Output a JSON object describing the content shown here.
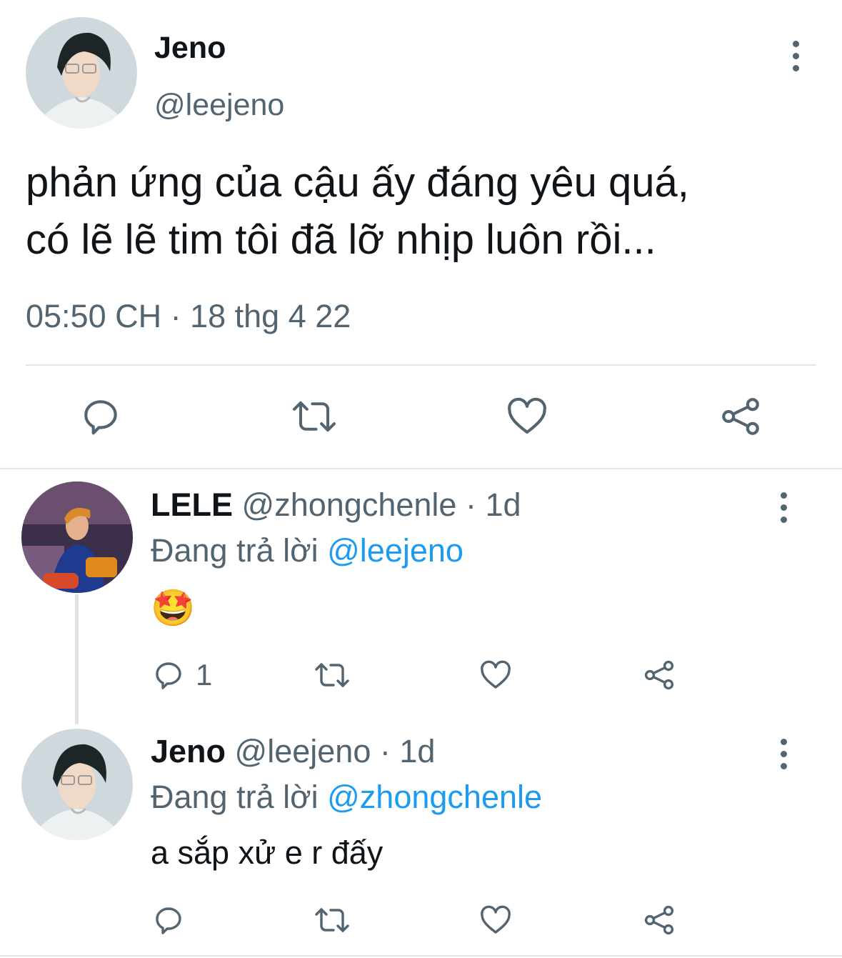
{
  "main_tweet": {
    "display_name": "Jeno",
    "handle": "@leejeno",
    "text_line1": "phản ứng của cậu ấy đáng yêu quá,",
    "text_line2": "có lẽ lẽ tim tôi đã lỡ nhịp luôn rồi...",
    "timestamp": "05:50 CH · 18 thg 4 22"
  },
  "reply1": {
    "display_name": "LELE",
    "handle": "@zhongchenle",
    "age": "· 1d",
    "replying_label": "Đang trả lời",
    "replying_to": "@leejeno",
    "text": "🤩",
    "reply_count": "1"
  },
  "reply2": {
    "display_name": "Jeno",
    "handle": "@leejeno",
    "age": "· 1d",
    "replying_label": "Đang trả lời",
    "replying_to": "@zhongchenle",
    "text": "a sắp xử e r đấy"
  },
  "icons": {
    "reply": "speech-bubble-icon",
    "retweet": "retweet-arrows-icon",
    "like": "heart-icon",
    "share": "share-nodes-icon",
    "more": "vertical-dots-icon"
  },
  "colors": {
    "text": "#0f1419",
    "secondary": "#536471",
    "link": "#1d9bf0",
    "divider": "#e1e6ea"
  }
}
